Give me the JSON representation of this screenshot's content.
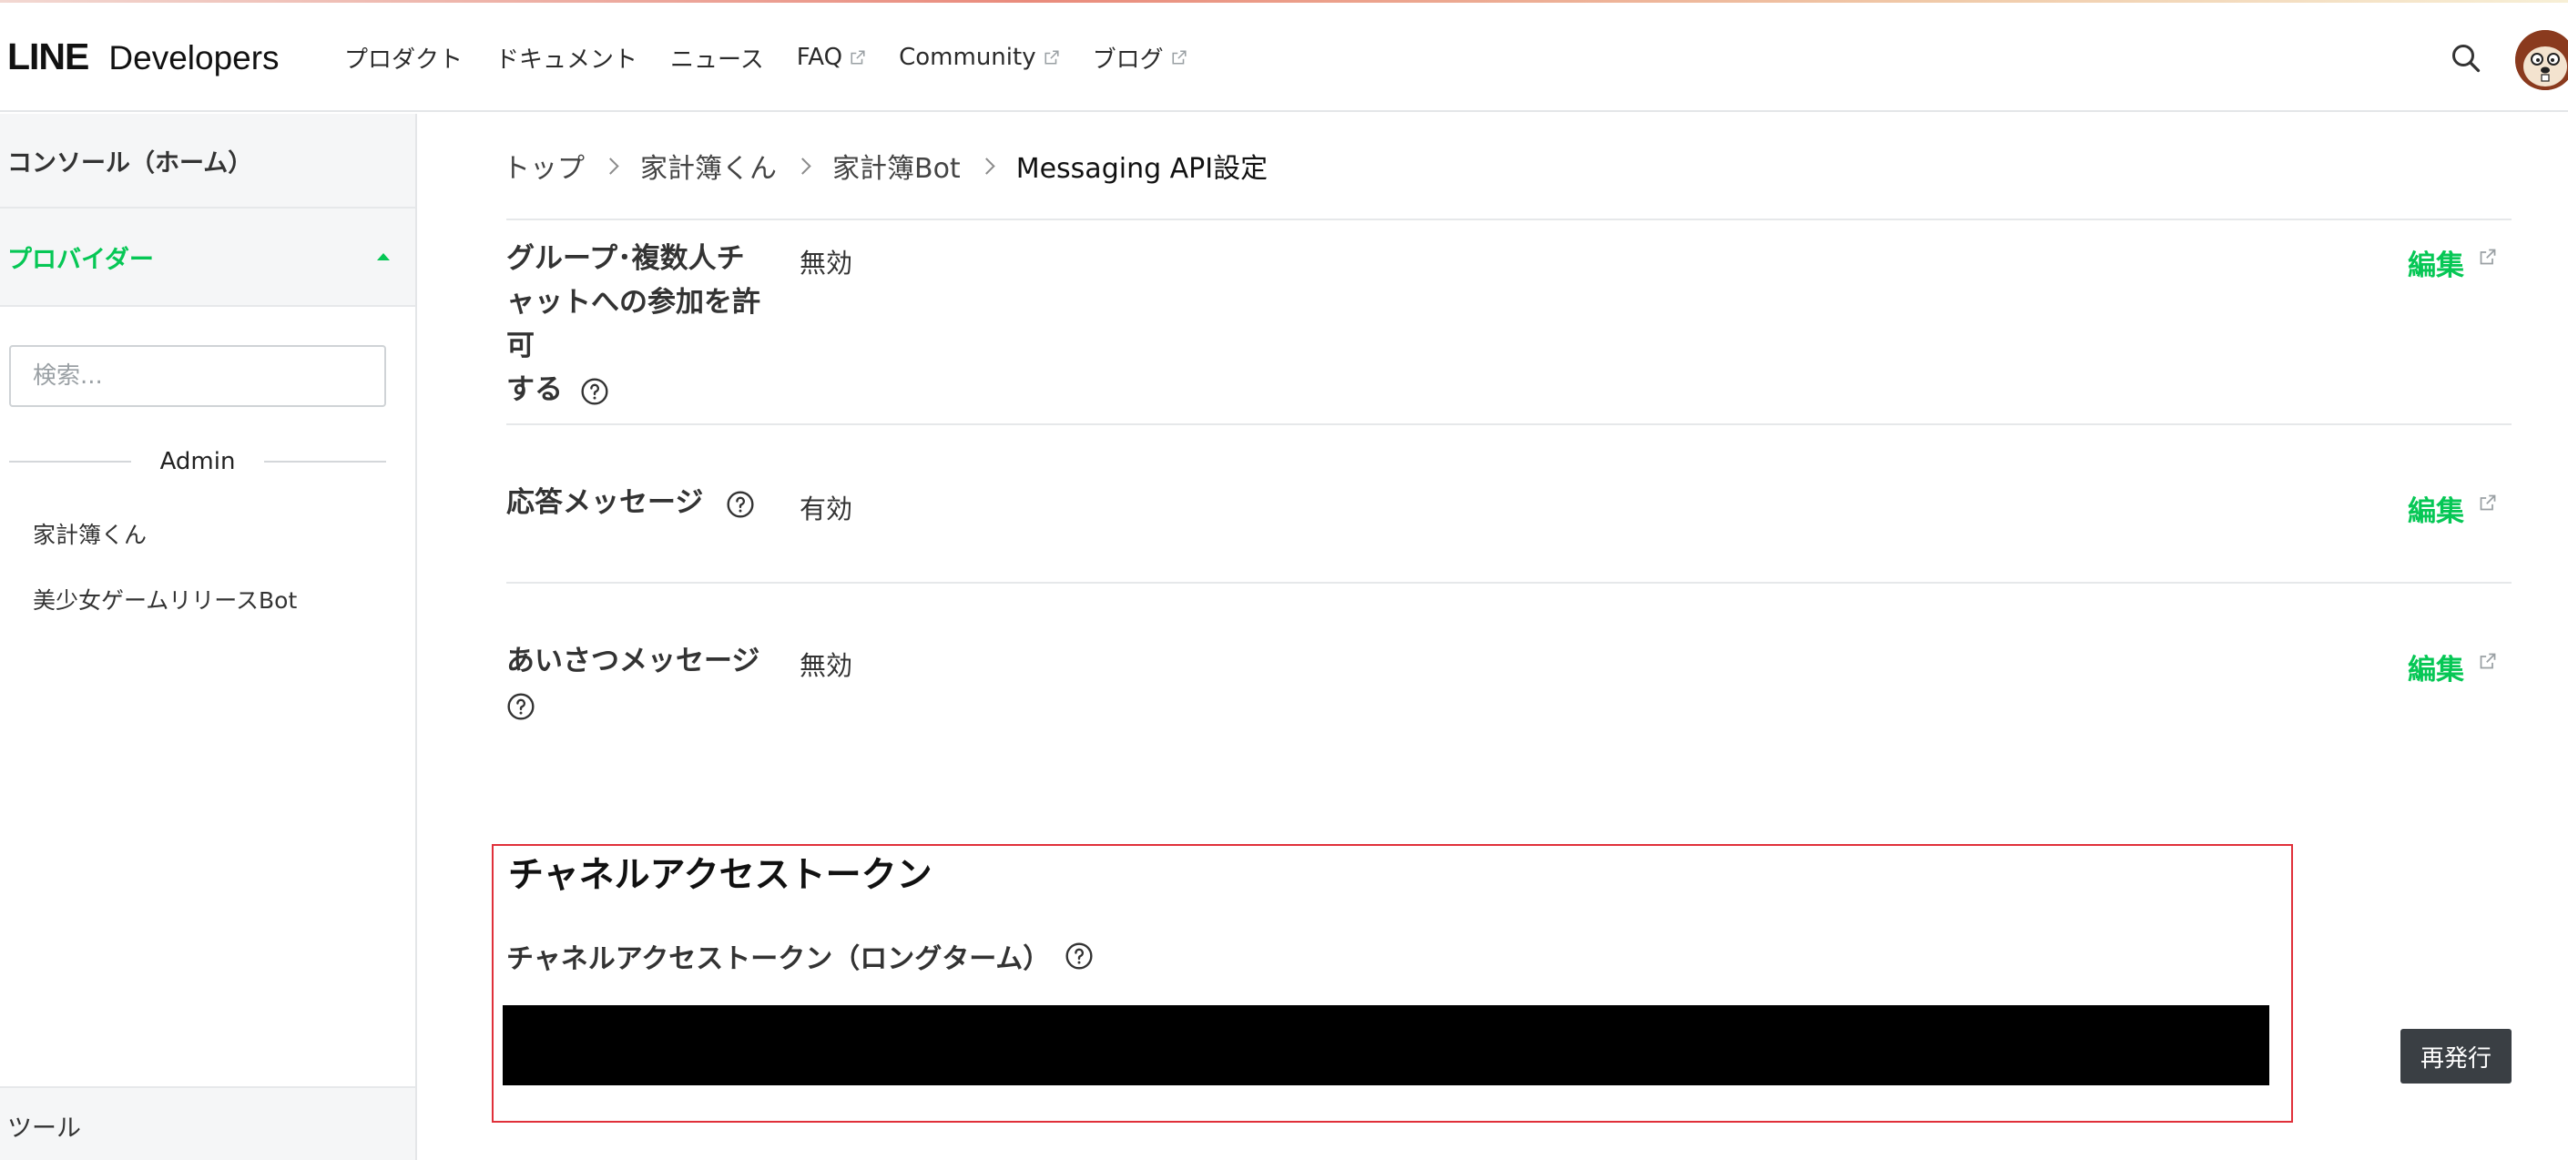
{
  "header": {
    "logo_line": "LINE",
    "logo_developers": "Developers",
    "nav": [
      {
        "label": "プロダクト",
        "external": false
      },
      {
        "label": "ドキュメント",
        "external": false
      },
      {
        "label": "ニュース",
        "external": false
      },
      {
        "label": "FAQ",
        "external": true
      },
      {
        "label": "Community",
        "external": true
      },
      {
        "label": "ブログ",
        "external": true
      }
    ]
  },
  "sidebar": {
    "console_label": "コンソール（ホーム）",
    "provider_label": "プロバイダー",
    "search_placeholder": "検索...",
    "group_label": "Admin",
    "items": [
      "家計簿くん",
      "美少女ゲームリリースBot"
    ],
    "tools_label": "ツール"
  },
  "breadcrumb": [
    "トップ",
    "家計簿くん",
    "家計簿Bot",
    "Messaging API設定"
  ],
  "settings": [
    {
      "label_lines": [
        "グループ･複数人チ",
        "ャットへの参加を許可",
        "する"
      ],
      "value": "無効",
      "edit_label": "編集"
    },
    {
      "label_lines": [
        "応答メッセージ"
      ],
      "value": "有効",
      "edit_label": "編集"
    },
    {
      "label_lines": [
        "あいさつメッセージ"
      ],
      "value": "無効",
      "edit_label": "編集"
    }
  ],
  "token": {
    "title": "チャネルアクセストークン",
    "subtitle": "チャネルアクセストークン（ロングターム）",
    "reissue_label": "再発行"
  },
  "colors": {
    "accent": "#06c755",
    "highlight_border": "#e0303a",
    "button_dark": "#3a3f44"
  },
  "icons": {
    "search": "search-icon",
    "external": "external-link-icon",
    "help": "help-circle-icon",
    "caret": "caret-up-icon"
  }
}
